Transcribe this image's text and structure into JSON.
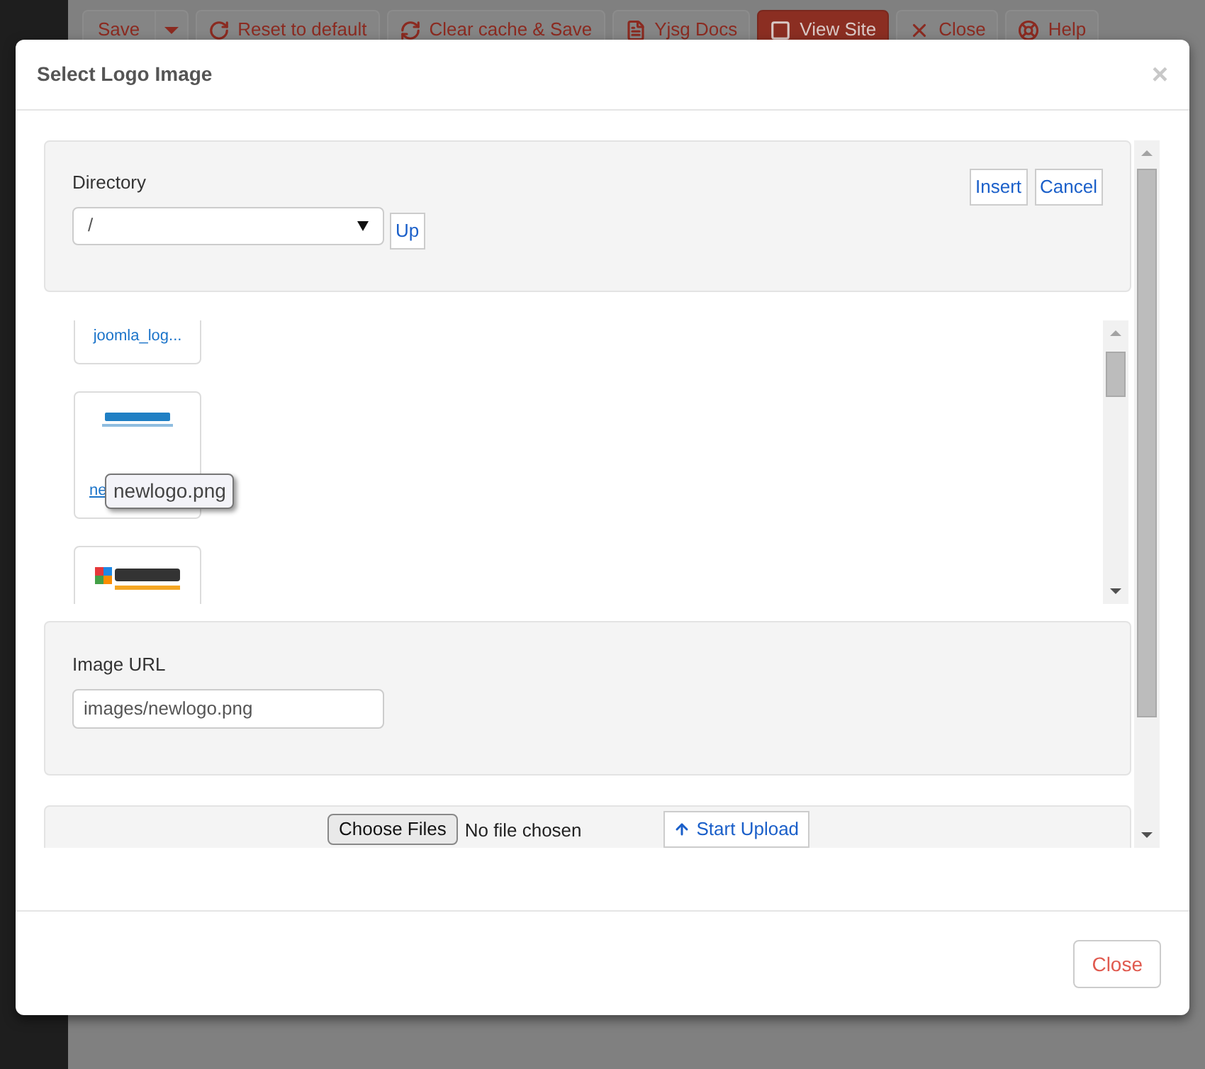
{
  "toolbar": [
    {
      "label": "Save",
      "kind": "split"
    },
    {
      "label": "Reset to default",
      "kind": "reset"
    },
    {
      "label": "Clear cache & Save",
      "kind": "refresh"
    },
    {
      "label": "Yjsg Docs",
      "kind": "docs"
    },
    {
      "label": "View Site",
      "kind": "primary"
    },
    {
      "label": "Close",
      "kind": "close"
    },
    {
      "label": "Help",
      "kind": "help"
    }
  ],
  "modal": {
    "title": "Select Logo Image",
    "close": "×",
    "directory": {
      "label": "Directory",
      "value": "/",
      "up": "Up",
      "insert": "Insert",
      "cancel": "Cancel"
    },
    "files": [
      {
        "name": "joomla_log..."
      },
      {
        "name": "ne",
        "kind": "picture",
        "tooltip": "newlogo.png"
      },
      {
        "kind": "picture"
      }
    ],
    "image_url": {
      "label": "Image URL",
      "value": "images/newlogo.png"
    },
    "upload": {
      "choose": "Choose Files",
      "status": "No file chosen",
      "start": "Start Upload"
    },
    "footer_button": "Close"
  }
}
